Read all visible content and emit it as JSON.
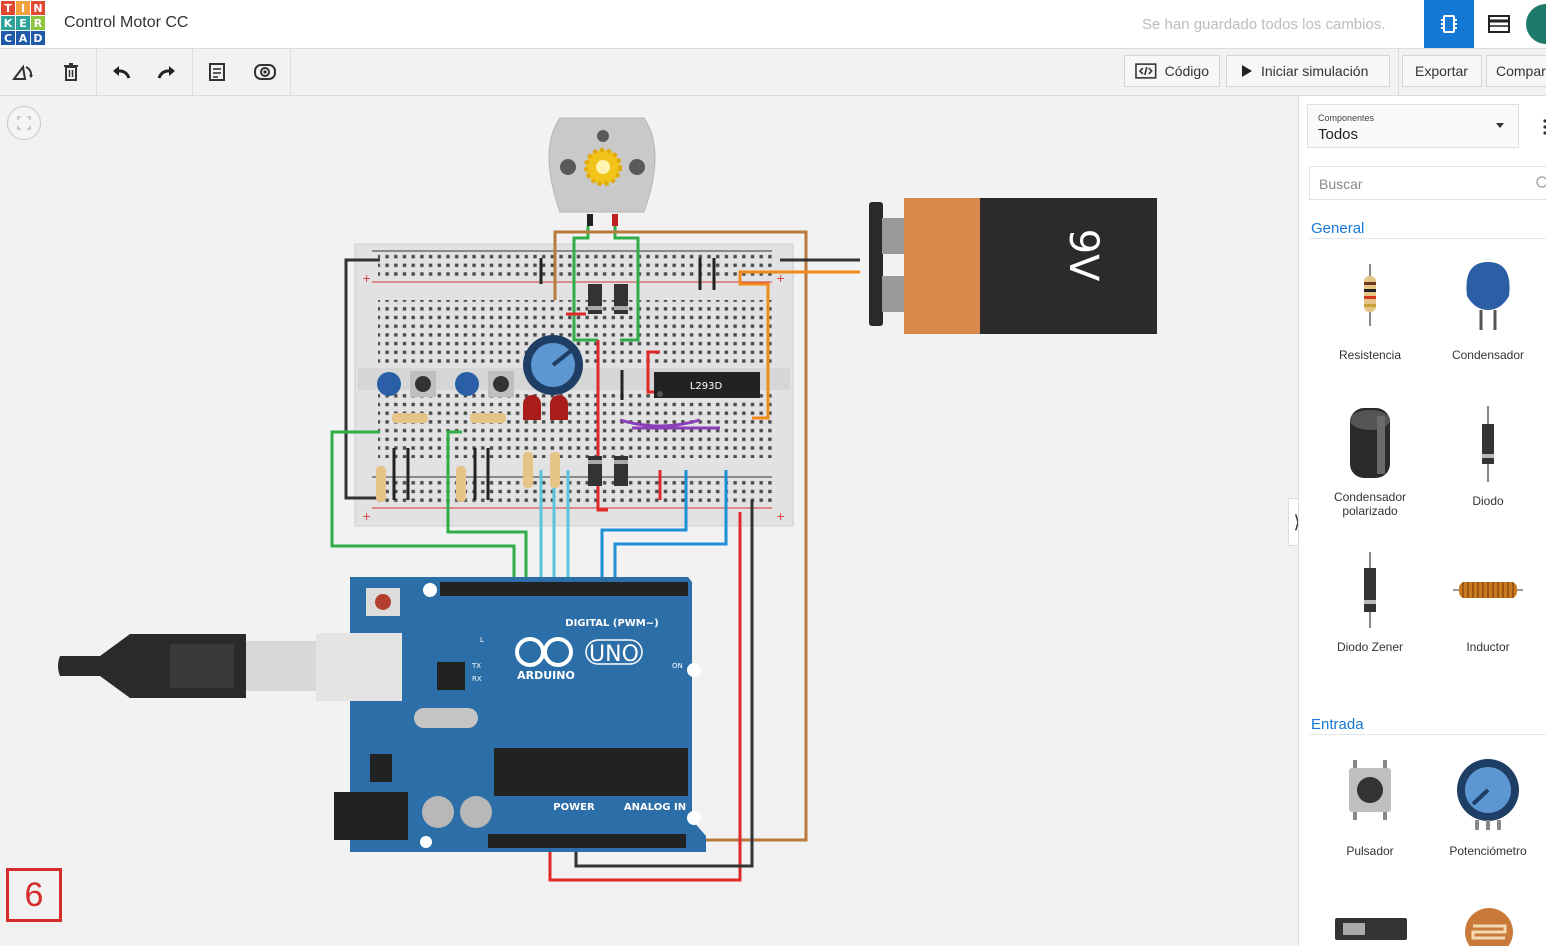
{
  "header": {
    "title": "Control Motor CC",
    "save_status": "Se han guardado todos los cambios.",
    "logo_letters": [
      "T",
      "I",
      "N",
      "K",
      "E",
      "R",
      "C",
      "A",
      "D"
    ],
    "logo_colors": [
      "#e2472f",
      "#f2a03c",
      "#e2472f",
      "#2ea39a",
      "#2ea39a",
      "#8dc63f",
      "#1e5aa8",
      "#1e5aa8",
      "#1e5aa8"
    ]
  },
  "toolbar": {
    "code_label": "Código",
    "simulate_label": "Iniciar simulación",
    "export_label": "Exportar",
    "share_label": "Compar"
  },
  "canvas": {
    "step_number": "6",
    "breadboard_chip": "L293D",
    "battery_label": "9V",
    "arduino": {
      "brand": "ARDUINO",
      "model": "UNO",
      "digital_header": "DIGITAL (PWM~)",
      "power_header": "POWER",
      "analog_header": "ANALOG IN",
      "on_label": "ON",
      "l_label": "L",
      "tx_label": "TX",
      "rx_label": "RX"
    }
  },
  "panel": {
    "dropdown_label": "Componentes",
    "dropdown_value": "Todos",
    "search_placeholder": "Buscar",
    "sections": [
      {
        "title": "General",
        "items": [
          {
            "label": "Resistencia",
            "icon": "resistor-icon"
          },
          {
            "label": "Condensador",
            "icon": "capacitor-icon"
          },
          {
            "label": "Condensador polarizado",
            "icon": "polarized-capacitor-icon"
          },
          {
            "label": "Diodo",
            "icon": "diode-icon"
          },
          {
            "label": "Diodo Zener",
            "icon": "zener-diode-icon"
          },
          {
            "label": "Inductor",
            "icon": "inductor-icon"
          }
        ]
      },
      {
        "title": "Entrada",
        "items": [
          {
            "label": "Pulsador",
            "icon": "pushbutton-icon"
          },
          {
            "label": "Potenciómetro",
            "icon": "potentiometer-icon"
          }
        ]
      }
    ]
  },
  "colors": {
    "accent": "#1477d4",
    "arduino_blue": "#2c6ea8",
    "battery_orange": "#d8894b",
    "step_red": "#d52b2b"
  }
}
